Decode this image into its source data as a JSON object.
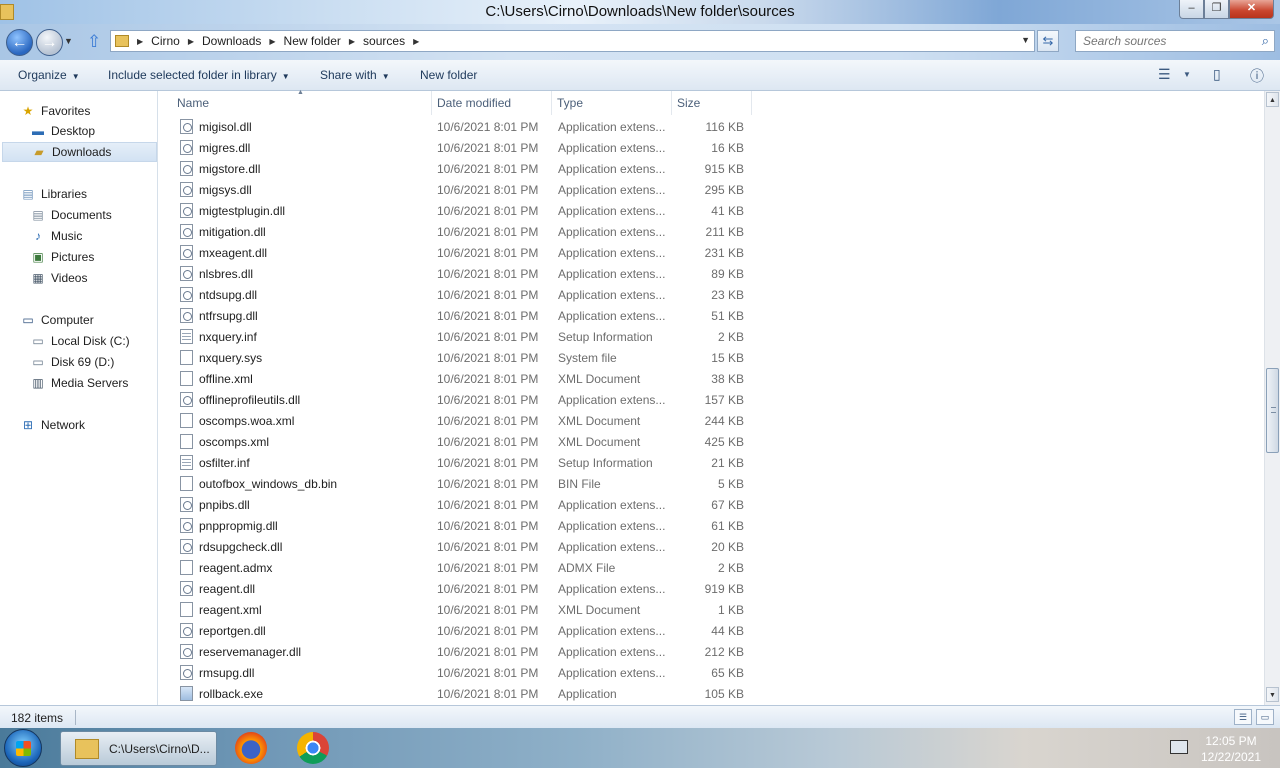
{
  "window": {
    "title": "C:\\Users\\Cirno\\Downloads\\New folder\\sources"
  },
  "controls": {
    "minimize": "–",
    "maximize": "❐",
    "close": "✕"
  },
  "address": {
    "breadcrumbs": [
      "Cirno",
      "Downloads",
      "New folder",
      "sources"
    ]
  },
  "search": {
    "placeholder": "Search sources"
  },
  "toolbar": {
    "organize": "Organize",
    "include": "Include selected folder in library",
    "share": "Share with",
    "new_folder": "New folder"
  },
  "nav": {
    "favorites": "Favorites",
    "desktop": "Desktop",
    "downloads": "Downloads",
    "libraries": "Libraries",
    "documents": "Documents",
    "music": "Music",
    "pictures": "Pictures",
    "videos": "Videos",
    "computer": "Computer",
    "local_disk": "Local Disk (C:)",
    "disk69": "Disk 69 (D:)",
    "media_servers": "Media Servers",
    "network": "Network"
  },
  "columns": {
    "name": "Name",
    "date": "Date modified",
    "type": "Type",
    "size": "Size"
  },
  "files": [
    {
      "name": "migisol.dll",
      "date": "10/6/2021 8:01 PM",
      "type": "Application extens...",
      "size": "116 KB",
      "icon": "dll"
    },
    {
      "name": "migres.dll",
      "date": "10/6/2021 8:01 PM",
      "type": "Application extens...",
      "size": "16 KB",
      "icon": "dll"
    },
    {
      "name": "migstore.dll",
      "date": "10/6/2021 8:01 PM",
      "type": "Application extens...",
      "size": "915 KB",
      "icon": "dll"
    },
    {
      "name": "migsys.dll",
      "date": "10/6/2021 8:01 PM",
      "type": "Application extens...",
      "size": "295 KB",
      "icon": "dll"
    },
    {
      "name": "migtestplugin.dll",
      "date": "10/6/2021 8:01 PM",
      "type": "Application extens...",
      "size": "41 KB",
      "icon": "dll"
    },
    {
      "name": "mitigation.dll",
      "date": "10/6/2021 8:01 PM",
      "type": "Application extens...",
      "size": "211 KB",
      "icon": "dll"
    },
    {
      "name": "mxeagent.dll",
      "date": "10/6/2021 8:01 PM",
      "type": "Application extens...",
      "size": "231 KB",
      "icon": "dll"
    },
    {
      "name": "nlsbres.dll",
      "date": "10/6/2021 8:01 PM",
      "type": "Application extens...",
      "size": "89 KB",
      "icon": "dll"
    },
    {
      "name": "ntdsupg.dll",
      "date": "10/6/2021 8:01 PM",
      "type": "Application extens...",
      "size": "23 KB",
      "icon": "dll"
    },
    {
      "name": "ntfrsupg.dll",
      "date": "10/6/2021 8:01 PM",
      "type": "Application extens...",
      "size": "51 KB",
      "icon": "dll"
    },
    {
      "name": "nxquery.inf",
      "date": "10/6/2021 8:01 PM",
      "type": "Setup Information",
      "size": "2 KB",
      "icon": "inf"
    },
    {
      "name": "nxquery.sys",
      "date": "10/6/2021 8:01 PM",
      "type": "System file",
      "size": "15 KB",
      "icon": "sys"
    },
    {
      "name": "offline.xml",
      "date": "10/6/2021 8:01 PM",
      "type": "XML Document",
      "size": "38 KB",
      "icon": "xml"
    },
    {
      "name": "offlineprofileutils.dll",
      "date": "10/6/2021 8:01 PM",
      "type": "Application extens...",
      "size": "157 KB",
      "icon": "dll"
    },
    {
      "name": "oscomps.woa.xml",
      "date": "10/6/2021 8:01 PM",
      "type": "XML Document",
      "size": "244 KB",
      "icon": "xml"
    },
    {
      "name": "oscomps.xml",
      "date": "10/6/2021 8:01 PM",
      "type": "XML Document",
      "size": "425 KB",
      "icon": "xml"
    },
    {
      "name": "osfilter.inf",
      "date": "10/6/2021 8:01 PM",
      "type": "Setup Information",
      "size": "21 KB",
      "icon": "inf"
    },
    {
      "name": "outofbox_windows_db.bin",
      "date": "10/6/2021 8:01 PM",
      "type": "BIN File",
      "size": "5 KB",
      "icon": "blank"
    },
    {
      "name": "pnpibs.dll",
      "date": "10/6/2021 8:01 PM",
      "type": "Application extens...",
      "size": "67 KB",
      "icon": "dll"
    },
    {
      "name": "pnppropmig.dll",
      "date": "10/6/2021 8:01 PM",
      "type": "Application extens...",
      "size": "61 KB",
      "icon": "dll"
    },
    {
      "name": "rdsupgcheck.dll",
      "date": "10/6/2021 8:01 PM",
      "type": "Application extens...",
      "size": "20 KB",
      "icon": "dll"
    },
    {
      "name": "reagent.admx",
      "date": "10/6/2021 8:01 PM",
      "type": "ADMX File",
      "size": "2 KB",
      "icon": "blank"
    },
    {
      "name": "reagent.dll",
      "date": "10/6/2021 8:01 PM",
      "type": "Application extens...",
      "size": "919 KB",
      "icon": "dll"
    },
    {
      "name": "reagent.xml",
      "date": "10/6/2021 8:01 PM",
      "type": "XML Document",
      "size": "1 KB",
      "icon": "xml"
    },
    {
      "name": "reportgen.dll",
      "date": "10/6/2021 8:01 PM",
      "type": "Application extens...",
      "size": "44 KB",
      "icon": "dll"
    },
    {
      "name": "reservemanager.dll",
      "date": "10/6/2021 8:01 PM",
      "type": "Application extens...",
      "size": "212 KB",
      "icon": "dll"
    },
    {
      "name": "rmsupg.dll",
      "date": "10/6/2021 8:01 PM",
      "type": "Application extens...",
      "size": "65 KB",
      "icon": "dll"
    },
    {
      "name": "rollback.exe",
      "date": "10/6/2021 8:01 PM",
      "type": "Application",
      "size": "105 KB",
      "icon": "exe"
    }
  ],
  "status": {
    "count": "182 items"
  },
  "taskbar": {
    "explorer_task": "C:\\Users\\Cirno\\D...",
    "time": "12:05 PM",
    "date": "12/22/2021"
  },
  "colors": {
    "selection": "#d3e2f3",
    "secondary_text": "#6d6d6d",
    "toolbar_text": "#1e395b"
  }
}
